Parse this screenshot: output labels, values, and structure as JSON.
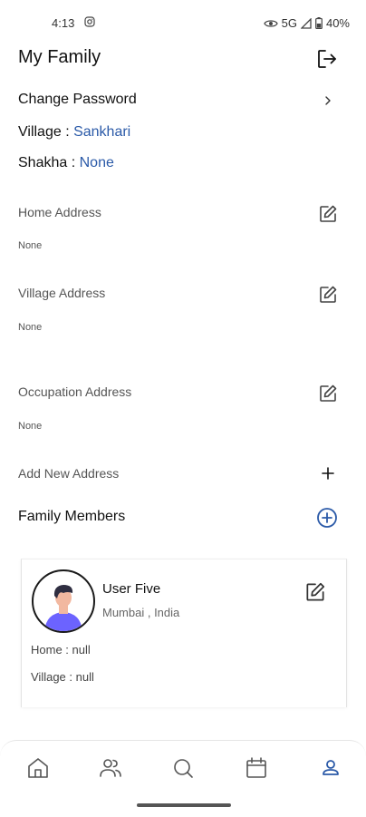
{
  "status_bar": {
    "time": "4:13",
    "network": "5G",
    "battery": "40%"
  },
  "header": {
    "title": "My Family"
  },
  "account": {
    "change_password_label": "Change Password",
    "village_label": "Village : ",
    "village_value": "Sankhari",
    "shakha_label": "Shakha : ",
    "shakha_value": "None"
  },
  "addresses": {
    "home": {
      "title": "Home Address",
      "value": "None"
    },
    "village": {
      "title": "Village Address",
      "value": "None"
    },
    "occupation": {
      "title": "Occupation Address",
      "value": "None"
    },
    "add_new_label": "Add New Address"
  },
  "family_members": {
    "title": "Family Members",
    "members": [
      {
        "name": "User Five",
        "location": "Mumbai , India",
        "home": "Home : null",
        "village": "Village : null"
      }
    ]
  },
  "bottom_nav": {
    "items": [
      "home-icon",
      "family-icon",
      "search-icon",
      "calendar-icon",
      "profile-icon"
    ],
    "active": "profile-icon"
  },
  "colors": {
    "accent": "#2b5aa8",
    "nav_active": "#2b5aa8"
  }
}
